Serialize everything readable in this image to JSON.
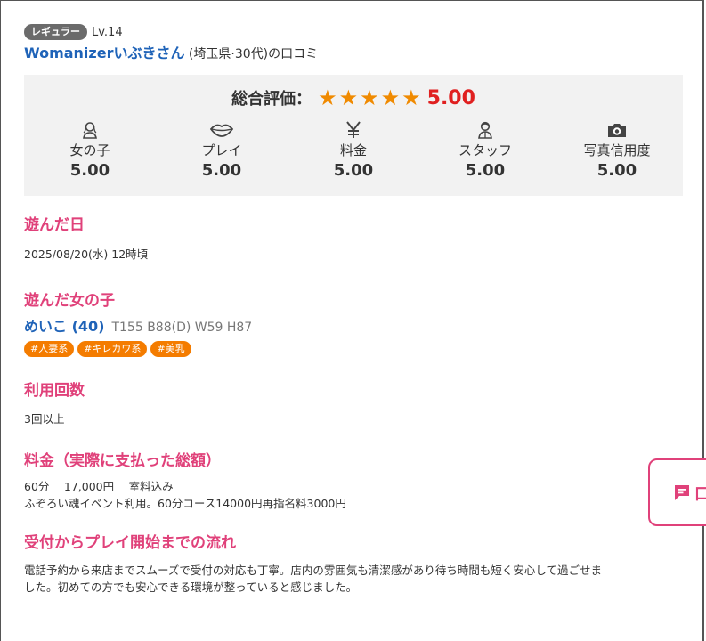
{
  "reviewer": {
    "rank_badge": "レギュラー",
    "level": "Lv.14",
    "name": "Womanizerいぶきさん",
    "suffix": " (埼玉県·30代)の口コミ"
  },
  "rating": {
    "label": "総合評価：",
    "stars": 5,
    "score": "5.00",
    "subscores": [
      {
        "icon": "girl-icon",
        "label": "女の子",
        "value": "5.00"
      },
      {
        "icon": "lips-icon",
        "label": "プレイ",
        "value": "5.00"
      },
      {
        "icon": "yen-icon",
        "label": "料金",
        "value": "5.00"
      },
      {
        "icon": "staff-icon",
        "label": "スタッフ",
        "value": "5.00"
      },
      {
        "icon": "camera-icon",
        "label": "写真信用度",
        "value": "5.00"
      }
    ]
  },
  "visit_date": {
    "title": "遊んだ日",
    "value": "2025/08/20(水) 12時頃"
  },
  "girl": {
    "title": "遊んだ女の子",
    "name": "めいこ (40)",
    "stats": "T155 B88(D) W59 H87",
    "tags": [
      "#人妻系",
      "#キレカワ系",
      "#美乳"
    ]
  },
  "usage": {
    "title": "利用回数",
    "value": "3回以上"
  },
  "price": {
    "title": "料金（実際に支払った総額）",
    "line1": "60分　 17,000円　 室料込み",
    "line2": "ふぞろい魂イベント利用。60分コース14000円再指名料3000円"
  },
  "flow": {
    "title": "受付からプレイ開始までの流れ",
    "line1": "電話予約から来店までスムーズで受付の対応も丁寧。店内の雰囲気も清潔感があり待ち時間も短く安心して過ごせま",
    "line2": "した。初めての方でも安心できる環境が整っていると感じました。"
  },
  "float_button": {
    "label": "口"
  },
  "colors": {
    "accent_pink": "#e0417a",
    "link_blue": "#1f63b8",
    "star_orange": "#f08a00",
    "score_red": "#e02020",
    "tag_orange": "#f47c00"
  }
}
